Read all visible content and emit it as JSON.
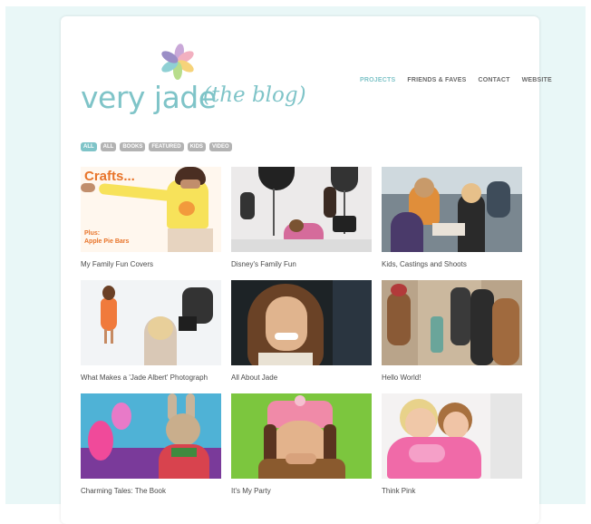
{
  "site": {
    "logo_text": "very jade",
    "logo_sub": "(the blog)"
  },
  "nav": {
    "items": [
      {
        "label": "PROJECTS",
        "active": true
      },
      {
        "label": "FRIENDS & FAVES",
        "active": false
      },
      {
        "label": "CONTACT",
        "active": false
      },
      {
        "label": "WEBSITE",
        "active": false
      }
    ]
  },
  "filters": [
    {
      "label": "ALL",
      "active": true
    },
    {
      "label": "ALL",
      "active": false
    },
    {
      "label": "BOOKS",
      "active": false
    },
    {
      "label": "FEATURED",
      "active": false
    },
    {
      "label": "KIDS",
      "active": false
    },
    {
      "label": "VIDEO",
      "active": false
    }
  ],
  "posts": [
    {
      "title": "My Family Fun Covers",
      "cover_title": "Crafts...",
      "cover_plus": "Plus:",
      "cover_line": "Apple Pie Bars"
    },
    {
      "title": "Disney's Family Fun"
    },
    {
      "title": "Kids, Castings and Shoots"
    },
    {
      "title": "What Makes a 'Jade Albert' Photograph"
    },
    {
      "title": "All About Jade"
    },
    {
      "title": "Hello World!"
    },
    {
      "title": "Charming Tales: The Book"
    },
    {
      "title": "It's My Party"
    },
    {
      "title": "Think Pink"
    }
  ],
  "colors": {
    "accent": "#7fc4c8",
    "page_bg": "#e9f7f7",
    "filter_bg": "#b3b3b3"
  }
}
